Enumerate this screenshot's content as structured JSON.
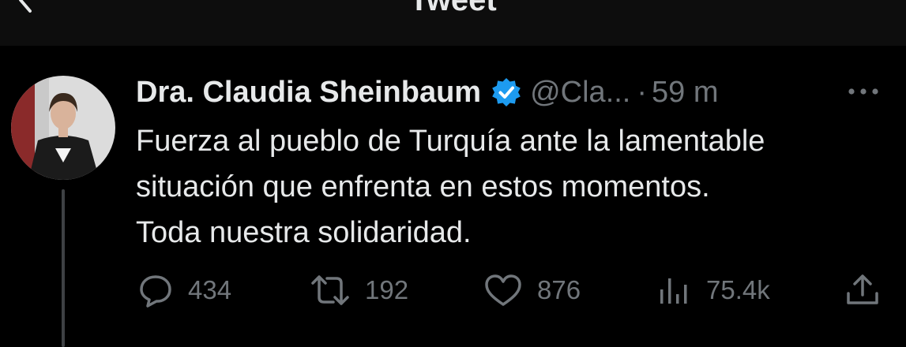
{
  "header": {
    "title": "Tweet",
    "back_icon": "back-arrow-icon"
  },
  "tweet": {
    "author_name": "Dra. Claudia Sheinbaum",
    "verified_icon": "verified-badge-icon",
    "handle": "@Cla...",
    "separator": "·",
    "time": "59 m",
    "more_icon": "more-dots-icon",
    "text": "Fuerza al pueblo de Turquía ante la lamentable\nsituación que enfrenta en estos momentos.\nToda nuestra solidaridad.",
    "actions": {
      "replies": "434",
      "retweets": "192",
      "likes": "876",
      "views": "75.4k"
    }
  },
  "colors": {
    "background": "#000000",
    "text_primary": "#e7e9ea",
    "text_secondary": "#71767b",
    "verified_blue": "#1d9bf0",
    "thread_line": "#3e4144"
  }
}
